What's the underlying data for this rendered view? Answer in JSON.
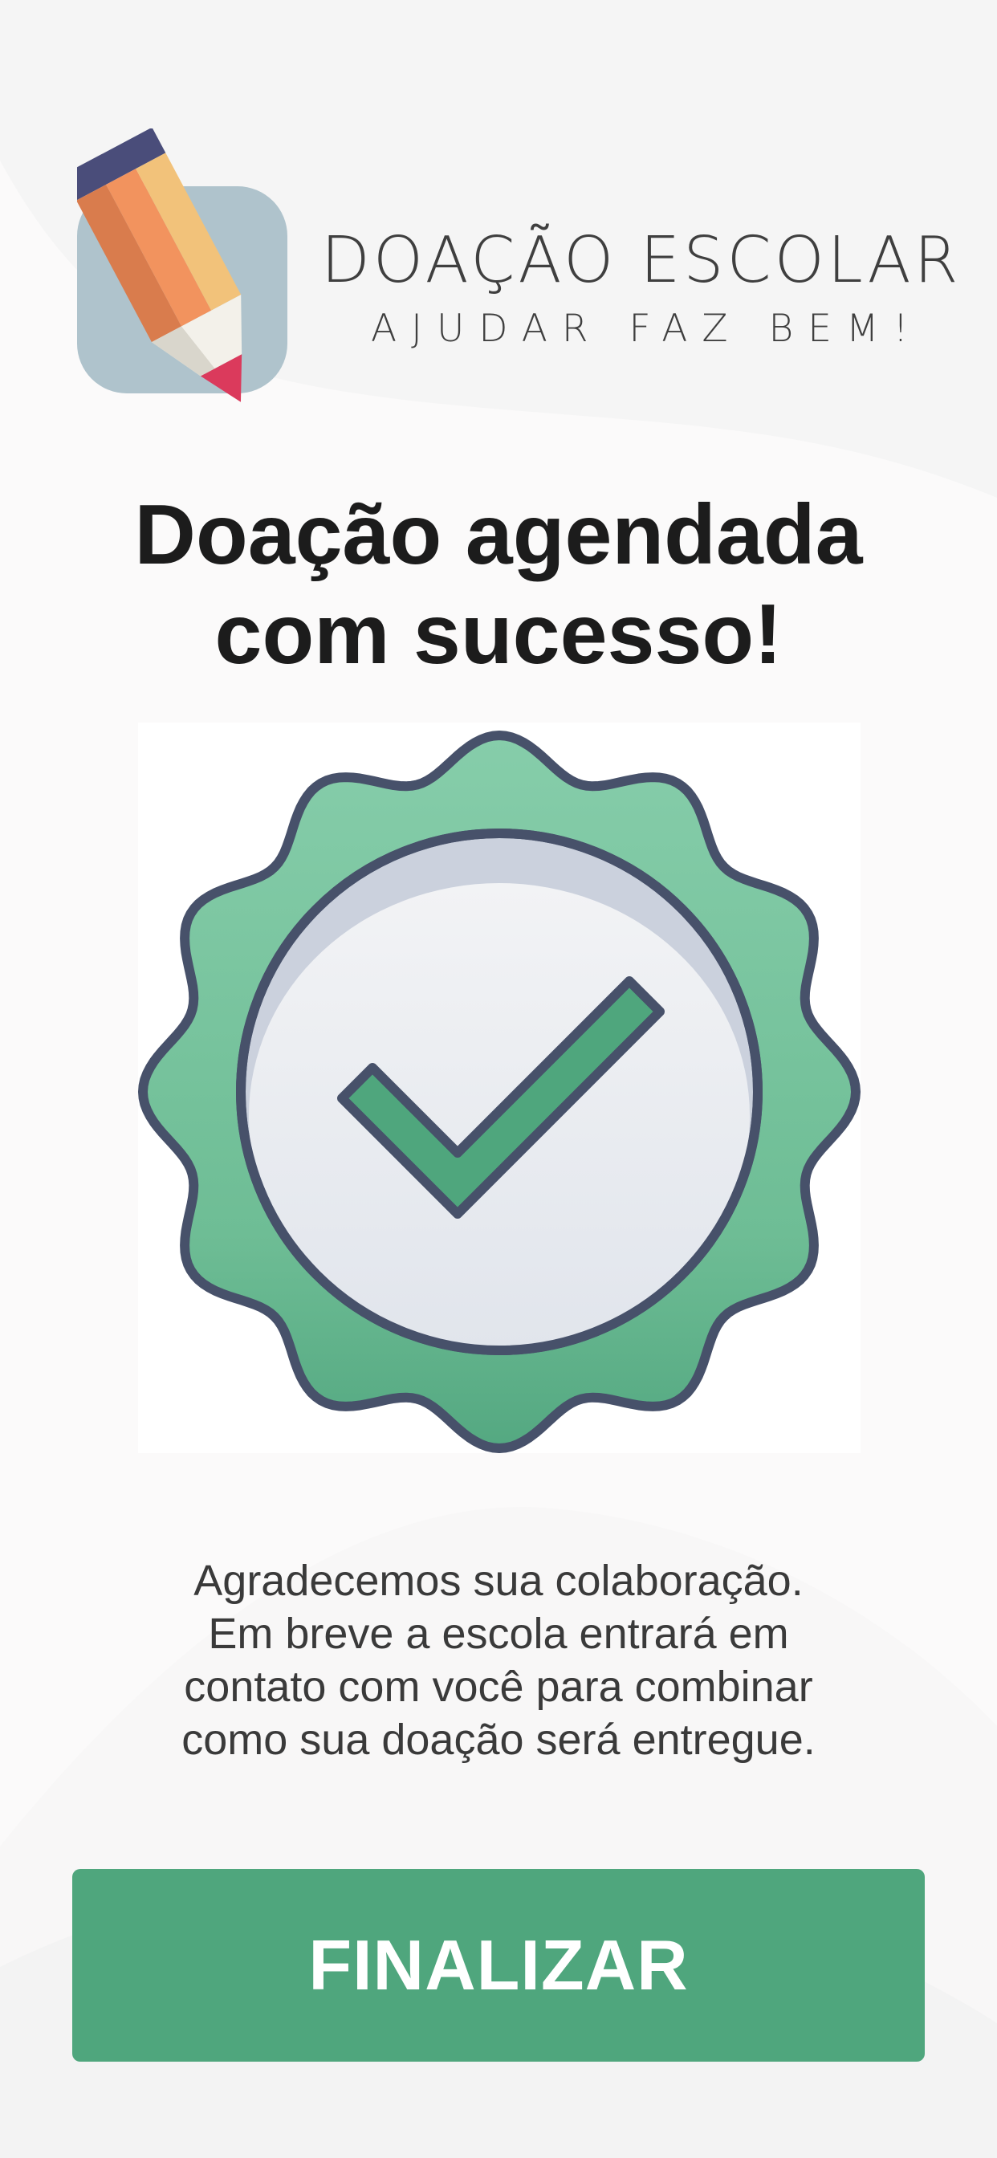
{
  "brand": {
    "title": "DOAÇÃO ESCOLAR",
    "tagline": "AJUDAR FAZ BEM!",
    "logo_icon": "pencil-icon"
  },
  "headline": {
    "line1": "Doação agendada",
    "line2": "com sucesso!"
  },
  "badge": {
    "icon": "checkmark-badge-icon"
  },
  "message": {
    "line1": "Agradecemos sua colaboração.",
    "line2": "Em breve a escola entrará em",
    "line3": "contato com você para combinar",
    "line4": "como sua doação será entregue."
  },
  "actions": {
    "finish_label": "FINALIZAR"
  },
  "colors": {
    "accent": "#4fa67d",
    "badge_green_light": "#82cba6",
    "outline": "#47516a",
    "headline_text": "#1c1c1c"
  }
}
